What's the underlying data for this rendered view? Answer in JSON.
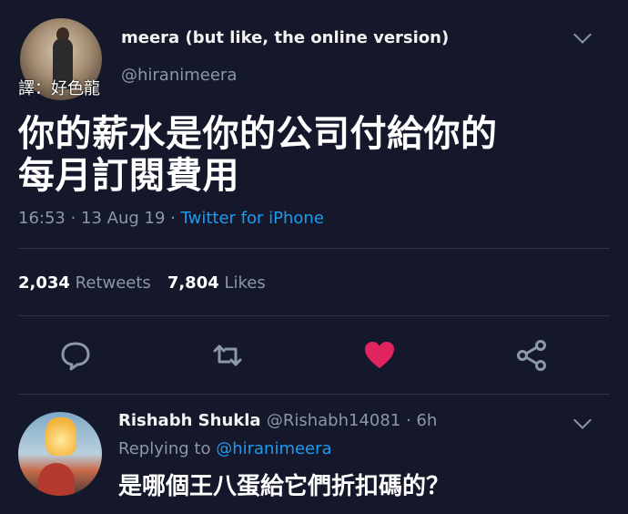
{
  "tweet": {
    "display_name": "meera (but like, the online version)",
    "handle": "@hiranimeera",
    "translator_note": "譯：好色龍",
    "text_line1": "你的薪水是你的公司付給你的",
    "text_line2": "每月訂閱費用",
    "time": "16:53",
    "sep1": " · ",
    "date": "13 Aug 19",
    "sep2": " · ",
    "source": "Twitter for iPhone",
    "retweets_count": "2,034",
    "retweets_label": "Retweets",
    "likes_count": "7,804",
    "likes_label": "Likes",
    "like_color": "#e0245e"
  },
  "reply": {
    "display_name": "Rishabh Shukla",
    "handle_time": "@Rishabh14081 · 6h",
    "replying_label": "Replying to ",
    "replying_mention": "@hiranimeera",
    "text": "是哪個王八蛋給它們折扣碼的？"
  },
  "colors": {
    "background": "#15182a",
    "muted_text": "#8b98a5",
    "link": "#1d9bf0"
  },
  "icons": [
    "reply-icon",
    "retweet-icon",
    "like-icon",
    "share-icon",
    "chevron-down-icon"
  ]
}
